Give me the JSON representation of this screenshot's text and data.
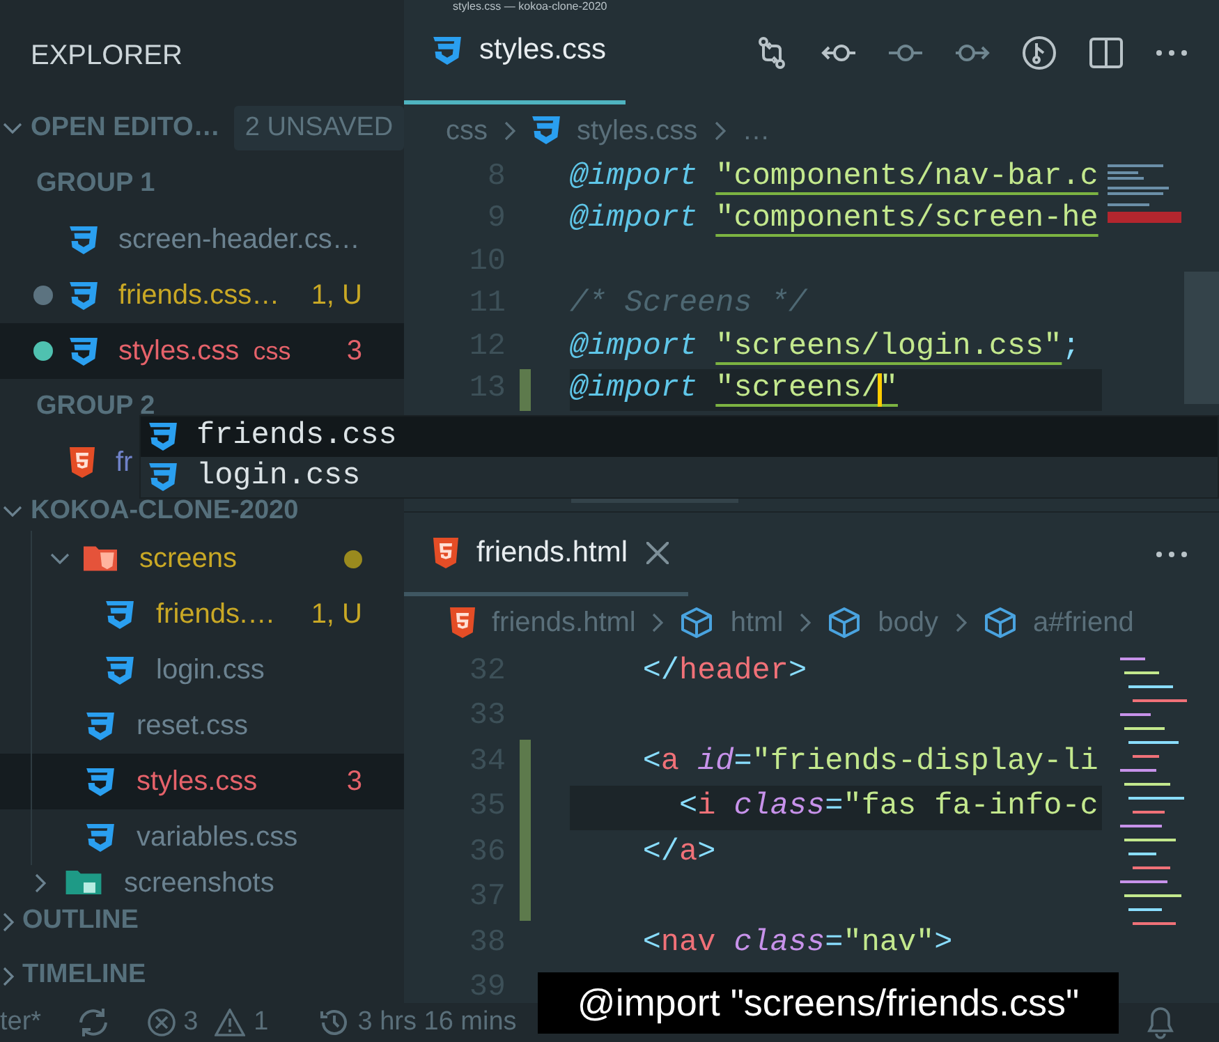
{
  "title_bar": {
    "title": "styles.css — kokoa-clone-2020"
  },
  "sidebar": {
    "title": "EXPLORER",
    "open_editors": {
      "label": "OPEN EDITO…",
      "expanded": true,
      "badge": "2 UNSAVED",
      "groups": [
        {
          "label": "GROUP 1",
          "items": [
            {
              "name": "screen-header.cs…",
              "kind": "css",
              "color": "#6b8290",
              "dirty": false,
              "selected": false
            },
            {
              "name": "friends.css…",
              "kind": "css",
              "color": "#c9a825",
              "dirty": true,
              "decoration": "1, U",
              "selected": false
            },
            {
              "name": "styles.css",
              "kind": "css",
              "color": "#e5626a",
              "dirty": true,
              "description": "css",
              "decoration": "3",
              "selected": true
            }
          ]
        },
        {
          "label": "GROUP 2",
          "items": [
            {
              "name": "fr",
              "kind": "html",
              "color": "#6f82c8",
              "dirty": false,
              "selected": false
            }
          ]
        }
      ]
    },
    "workspace": {
      "label": "KOKOA-CLONE-2020",
      "expanded": true,
      "tree": [
        {
          "children": [
            {
              "name": "screens",
              "kind": "pagefolder",
              "expanded": true,
              "color": "#c9a825",
              "dot": true,
              "selected": false,
              "children": [
                {
                  "name": "friends.…",
                  "kind": "css",
                  "color": "#c9a825",
                  "decoration": "1, U",
                  "selected": false
                },
                {
                  "name": "login.css",
                  "kind": "css",
                  "color": "#6b8290",
                  "selected": false
                }
              ]
            },
            {
              "name": "reset.css",
              "kind": "css",
              "color": "#6b8290",
              "selected": false
            },
            {
              "name": "styles.css",
              "kind": "css",
              "color": "#e5626a",
              "decoration": "3",
              "selected": true
            },
            {
              "name": "variables.css",
              "kind": "css",
              "color": "#6b8290",
              "selected": false
            }
          ]
        },
        {
          "name": "screenshots",
          "kind": "imagefolder",
          "expanded": false,
          "color": "#6b8290",
          "selected": false
        }
      ]
    },
    "outline": {
      "label": "OUTLINE",
      "expanded": false
    },
    "timeline": {
      "label": "TIMELINE",
      "expanded": false
    }
  },
  "editors": [
    {
      "focused": true,
      "full_toolbar": true,
      "kind": "css",
      "tabs": [
        {
          "label": "styles.css",
          "kind": "css",
          "selected": true,
          "closable": false
        }
      ],
      "breadcrumb": [
        {
          "label": "css"
        },
        {
          "label": "styles.css",
          "kind": "css"
        },
        {
          "label": "…"
        }
      ],
      "lines": [
        {
          "number": "8",
          "modified": false,
          "current": false,
          "tokens": [
            {
              "kind": "at-rule",
              "text": "@import "
            },
            {
              "kind": "string",
              "text": "\"components/nav-bar.c"
            }
          ]
        },
        {
          "number": "9",
          "modified": false,
          "current": false,
          "tokens": [
            {
              "kind": "at-rule",
              "text": "@import "
            },
            {
              "kind": "string",
              "text": "\"components/screen-he"
            }
          ]
        },
        {
          "number": "10",
          "modified": false,
          "current": false
        },
        {
          "number": "11",
          "modified": false,
          "current": false,
          "tokens": [
            {
              "kind": "comment",
              "text": "/* Screens */"
            }
          ]
        },
        {
          "number": "12",
          "modified": false,
          "current": false,
          "tokens": [
            {
              "kind": "at-rule",
              "text": "@import "
            },
            {
              "kind": "string",
              "text": "\"screens/login.css\""
            },
            {
              "kind": "punct",
              "text": ";"
            }
          ]
        },
        {
          "number": "13",
          "modified": true,
          "current": true,
          "tokens": [
            {
              "kind": "at-rule",
              "text": "@import "
            },
            {
              "kind": "string",
              "text": "\"screens/",
              "cursor_after": true
            },
            {
              "kind": "string",
              "text": "\""
            }
          ]
        }
      ]
    },
    {
      "focused": false,
      "full_toolbar": false,
      "kind": "html",
      "tabs": [
        {
          "label": "friends.html",
          "kind": "html",
          "selected": true,
          "closable": true
        }
      ],
      "breadcrumb": [
        {
          "label": "friends.html",
          "kind": "html"
        },
        {
          "label": "html",
          "kind": "symbol"
        },
        {
          "label": "body",
          "kind": "symbol"
        },
        {
          "label": "a#friend",
          "kind": "symbol"
        }
      ],
      "lines": [
        {
          "number": "32",
          "modified": false,
          "current": false,
          "tokens": [
            {
              "kind": "punct",
              "text": "    </"
            },
            {
              "kind": "tag",
              "text": "header"
            },
            {
              "kind": "punct",
              "text": ">"
            }
          ]
        },
        {
          "number": "33",
          "modified": false,
          "current": false
        },
        {
          "number": "34",
          "modified": true,
          "current": false,
          "tokens": [
            {
              "kind": "punct",
              "text": "    <"
            },
            {
              "kind": "tag",
              "text": "a "
            },
            {
              "kind": "attr",
              "text": "id"
            },
            {
              "kind": "punct",
              "text": "="
            },
            {
              "kind": "string",
              "text": "\"friends-display-li"
            }
          ]
        },
        {
          "number": "35",
          "modified": true,
          "current": true,
          "tokens": [
            {
              "kind": "punct",
              "text": "      <"
            },
            {
              "kind": "tag",
              "text": "i "
            },
            {
              "kind": "attr",
              "text": "class"
            },
            {
              "kind": "punct",
              "text": "="
            },
            {
              "kind": "string",
              "text": "\"fas fa-info-c"
            }
          ]
        },
        {
          "number": "36",
          "modified": true,
          "current": false,
          "tokens": [
            {
              "kind": "punct",
              "text": "    </"
            },
            {
              "kind": "tag",
              "text": "a"
            },
            {
              "kind": "punct",
              "text": ">"
            }
          ]
        },
        {
          "number": "37",
          "modified": true,
          "current": false
        },
        {
          "number": "38",
          "modified": false,
          "current": false,
          "tokens": [
            {
              "kind": "punct",
              "text": "    <"
            },
            {
              "kind": "tag",
              "text": "nav "
            },
            {
              "kind": "attr",
              "text": "class"
            },
            {
              "kind": "punct",
              "text": "="
            },
            {
              "kind": "string",
              "text": "\"nav\""
            },
            {
              "kind": "punct",
              "text": ">"
            }
          ]
        },
        {
          "number": "39",
          "modified": false,
          "current": false
        }
      ]
    }
  ],
  "autocomplete": {
    "items": [
      {
        "label": "friends.css",
        "kind": "css",
        "selected": true
      },
      {
        "label": "login.css",
        "kind": "css",
        "selected": false
      }
    ]
  },
  "status_bar": {
    "items": [
      {
        "kind": "text",
        "text": "ter*"
      },
      {
        "kind": "sync"
      },
      {
        "kind": "errors",
        "text": "3"
      },
      {
        "kind": "warnings",
        "text": "1"
      },
      {
        "kind": "history",
        "text": "3 hrs 16 mins"
      },
      {
        "kind": "notifications"
      }
    ]
  },
  "caption": {
    "text": "@import \"screens/friends.css\""
  }
}
